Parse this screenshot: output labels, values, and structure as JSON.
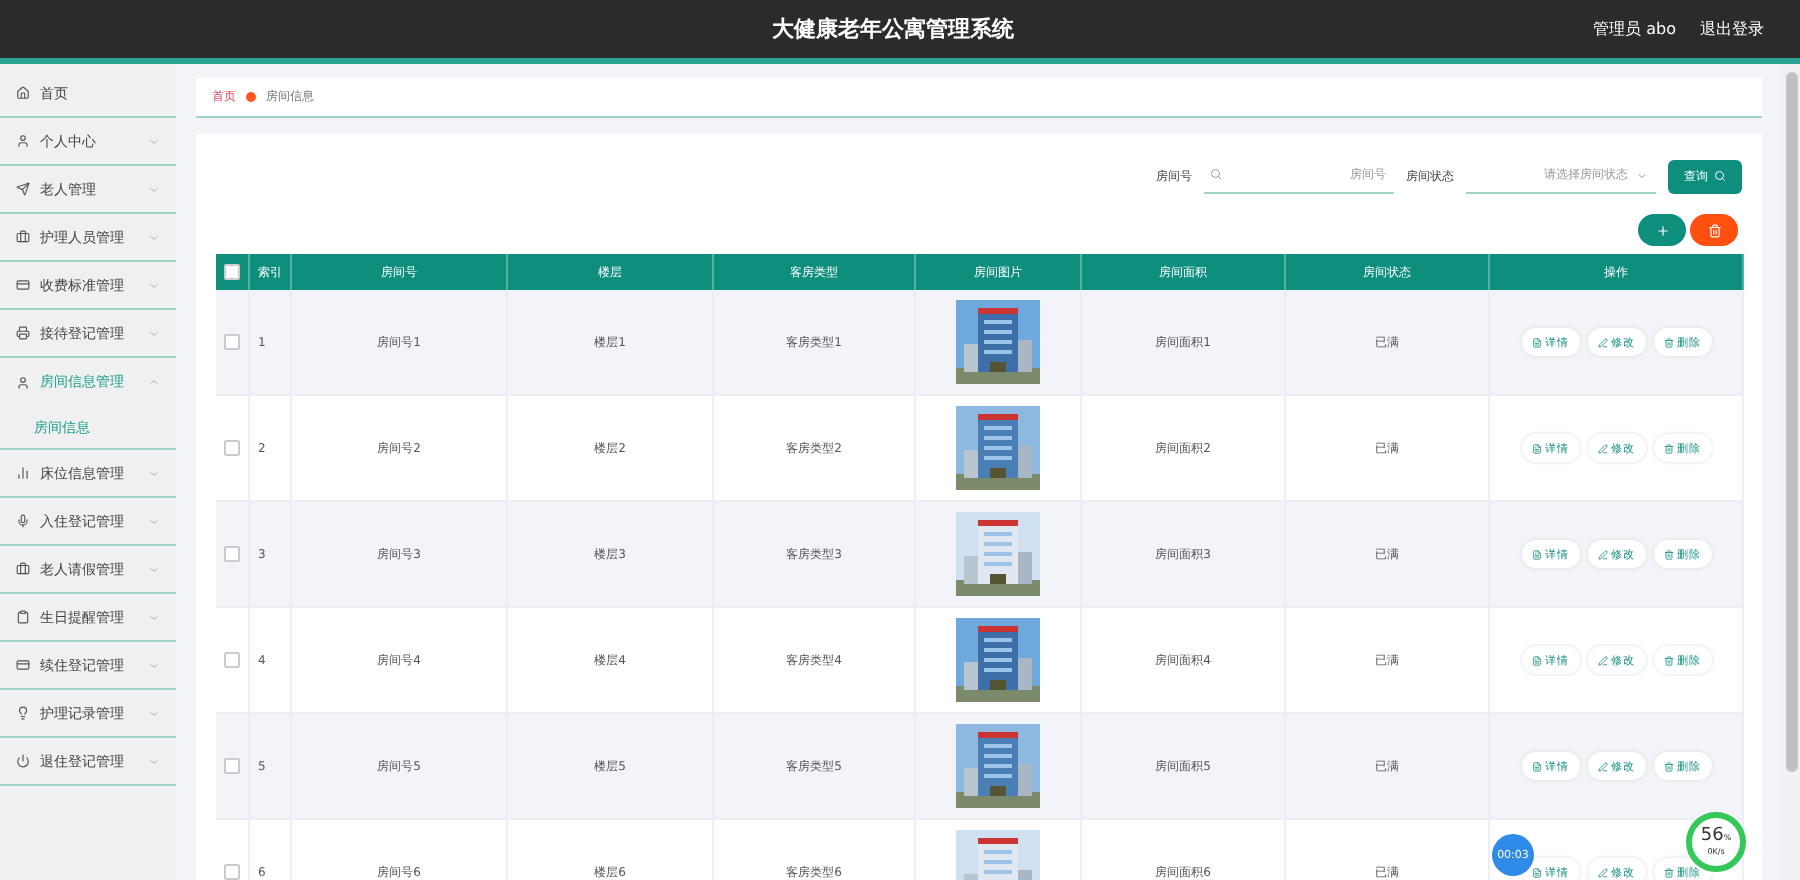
{
  "header": {
    "title": "大健康老年公寓管理系统",
    "user": "管理员 abo",
    "logout": "退出登录"
  },
  "sidebar": {
    "items": [
      {
        "label": "首页",
        "kind": "link"
      },
      {
        "label": "个人中心",
        "kind": "menu",
        "expanded": false
      },
      {
        "label": "老人管理",
        "kind": "menu",
        "expanded": false
      },
      {
        "label": "护理人员管理",
        "kind": "menu",
        "expanded": false
      },
      {
        "label": "收费标准管理",
        "kind": "menu",
        "expanded": false
      },
      {
        "label": "接待登记管理",
        "kind": "menu",
        "expanded": false
      },
      {
        "label": "房间信息管理",
        "kind": "menu",
        "expanded": true,
        "children": [
          {
            "label": "房间信息",
            "selected": true
          }
        ]
      },
      {
        "label": "床位信息管理",
        "kind": "menu",
        "expanded": false
      },
      {
        "label": "入住登记管理",
        "kind": "menu",
        "expanded": false
      },
      {
        "label": "老人请假管理",
        "kind": "menu",
        "expanded": false
      },
      {
        "label": "生日提醒管理",
        "kind": "menu",
        "expanded": false
      },
      {
        "label": "续住登记管理",
        "kind": "menu",
        "expanded": false
      },
      {
        "label": "护理记录管理",
        "kind": "menu",
        "expanded": false
      },
      {
        "label": "退住登记管理",
        "kind": "menu",
        "expanded": false
      }
    ]
  },
  "breadcrumb": [
    "首页",
    "房间信息"
  ],
  "search": {
    "fields": [
      {
        "label": "房间号",
        "kind": "text",
        "placeholder": "房间号"
      },
      {
        "label": "房间状态",
        "kind": "select",
        "placeholder": "请选择房间状态"
      }
    ],
    "button": "查询"
  },
  "table": {
    "all_checked": false,
    "columns": [
      "索引",
      "房间号",
      "楼层",
      "客房类型",
      "房间图片",
      "房间面积",
      "房间状态",
      "操作"
    ],
    "rows": [
      {
        "checked": false,
        "index": "1",
        "room": "房间号1",
        "floor": "楼层1",
        "type": "客房类型1",
        "area": "房间面积1",
        "status": "已满",
        "actions": [
          "详情",
          "修改",
          "删除"
        ]
      },
      {
        "checked": false,
        "index": "2",
        "room": "房间号2",
        "floor": "楼层2",
        "type": "客房类型2",
        "area": "房间面积2",
        "status": "已满",
        "actions": [
          "详情",
          "修改",
          "删除"
        ]
      },
      {
        "checked": false,
        "index": "3",
        "room": "房间号3",
        "floor": "楼层3",
        "type": "客房类型3",
        "area": "房间面积3",
        "status": "已满",
        "actions": [
          "详情",
          "修改",
          "删除"
        ]
      },
      {
        "checked": false,
        "index": "4",
        "room": "房间号4",
        "floor": "楼层4",
        "type": "客房类型4",
        "area": "房间面积4",
        "status": "已满",
        "actions": [
          "详情",
          "修改",
          "删除"
        ]
      },
      {
        "checked": false,
        "index": "5",
        "room": "房间号5",
        "floor": "楼层5",
        "type": "客房类型5",
        "area": "房间面积5",
        "status": "已满",
        "actions": [
          "详情",
          "修改",
          "删除"
        ]
      },
      {
        "checked": false,
        "index": "6",
        "room": "房间号6",
        "floor": "楼层6",
        "type": "客房类型6",
        "area": "房间面积6",
        "status": "已满",
        "actions": [
          "详情",
          "修改",
          "删除"
        ]
      }
    ]
  },
  "overlays": {
    "timer": "00:03",
    "meter_percent": "56",
    "meter_unit": "%",
    "meter_rate": "0K/s"
  }
}
